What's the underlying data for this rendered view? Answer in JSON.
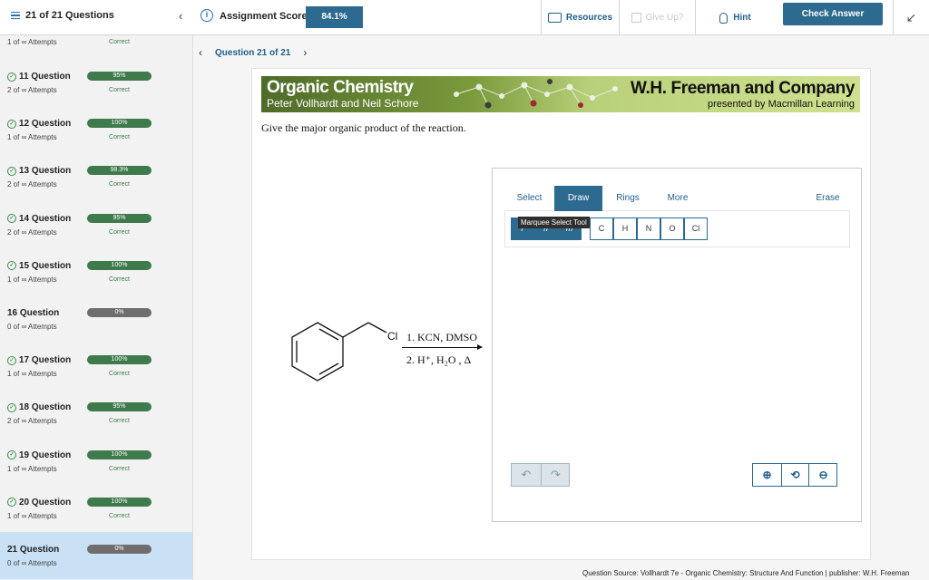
{
  "topbar": {
    "question_count": "21 of 21 Questions",
    "score_label": "Assignment Score:",
    "score_value": "84.1%",
    "resources": "Resources",
    "give_up": "Give Up?",
    "hint": "Hint",
    "check_answer": "Check Answer",
    "collapse_glyph": "↙"
  },
  "sidebar": {
    "partial_top": {
      "attempts": "1 of ∞ Attempts",
      "status": "Correct"
    },
    "items": [
      {
        "title": "11 Question",
        "attempts": "2 of ∞ Attempts",
        "score": "95%",
        "status": "Correct",
        "done": true
      },
      {
        "title": "12 Question",
        "attempts": "1 of ∞ Attempts",
        "score": "100%",
        "status": "Correct",
        "done": true
      },
      {
        "title": "13 Question",
        "attempts": "2 of ∞ Attempts",
        "score": "98.3%",
        "status": "Correct",
        "done": true
      },
      {
        "title": "14 Question",
        "attempts": "2 of ∞ Attempts",
        "score": "95%",
        "status": "Correct",
        "done": true
      },
      {
        "title": "15 Question",
        "attempts": "1 of ∞ Attempts",
        "score": "100%",
        "status": "Correct",
        "done": true
      },
      {
        "title": "16 Question",
        "attempts": "0 of ∞ Attempts",
        "score": "0%",
        "status": "",
        "done": false
      },
      {
        "title": "17 Question",
        "attempts": "1 of ∞ Attempts",
        "score": "100%",
        "status": "Correct",
        "done": true
      },
      {
        "title": "18 Question",
        "attempts": "2 of ∞ Attempts",
        "score": "95%",
        "status": "Correct",
        "done": true
      },
      {
        "title": "19 Question",
        "attempts": "1 of ∞ Attempts",
        "score": "100%",
        "status": "Correct",
        "done": true
      },
      {
        "title": "20 Question",
        "attempts": "1 of ∞ Attempts",
        "score": "100%",
        "status": "Correct",
        "done": true
      },
      {
        "title": "21 Question",
        "attempts": "0 of ∞ Attempts",
        "score": "0%",
        "status": "",
        "done": false,
        "active": true
      }
    ]
  },
  "main": {
    "question_nav": "Question 21 of 21",
    "banner": {
      "title": "Organic Chemistry",
      "authors": "Peter Vollhardt and Neil Schore",
      "publisher": "W.H. Freeman and Company",
      "presented_by": "presented by Macmillan Learning"
    },
    "prompt": "Give the major organic product of the reaction.",
    "reaction": {
      "halogen": "Cl",
      "step1": "1. KCN, DMSO",
      "step2": "2. H⁺, H₂O , Δ"
    },
    "tool": {
      "tabs": [
        "Select",
        "Draw",
        "Rings",
        "More",
        "Erase"
      ],
      "active_tab": "Draw",
      "tooltip": "Marquee Select Tool",
      "atoms": [
        "C",
        "H",
        "N",
        "O",
        "Cl"
      ]
    },
    "footer": "Question Source: Vollhardt 7e - Organic Chemistry: Structure And Function  |  publisher: W.H. Freeman"
  }
}
